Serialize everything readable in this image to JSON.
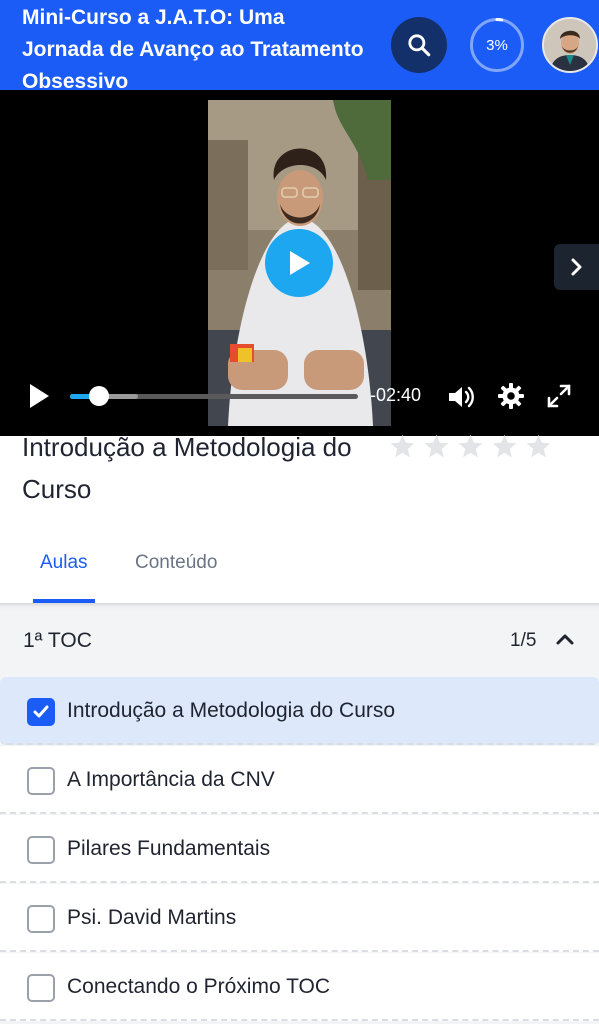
{
  "header": {
    "title": "Mini-Curso a J.A.T.O: Uma Jornada de Avanço ao Tratamento Obsessivo",
    "progress_label": "3%",
    "progress_value": 0.03,
    "search_icon": "search-icon",
    "brand_color": "#1a5cf5"
  },
  "player": {
    "time_remaining": "-02:40",
    "played_fraction": 0.1,
    "icons": [
      "play-icon",
      "volume-icon",
      "gear-icon",
      "fullscreen-icon",
      "chevron-right-icon"
    ],
    "accent_color": "#1ca7f0"
  },
  "lesson": {
    "title": "Introdução a Metodologia do Curso",
    "rating_stars": 5,
    "rating_value": 0
  },
  "tabs": [
    {
      "label": "Aulas",
      "active": true
    },
    {
      "label": "Conteúdo",
      "active": false
    }
  ],
  "module": {
    "name": "1ª TOC",
    "count": "1/5",
    "lessons": [
      {
        "label": "Introdução a Metodologia do Curso",
        "checked": true
      },
      {
        "label": "A Importância da CNV",
        "checked": false
      },
      {
        "label": "Pilares Fundamentais",
        "checked": false
      },
      {
        "label": "Psi. David Martins",
        "checked": false
      },
      {
        "label": "Conectando o Próximo TOC",
        "checked": false
      }
    ]
  }
}
